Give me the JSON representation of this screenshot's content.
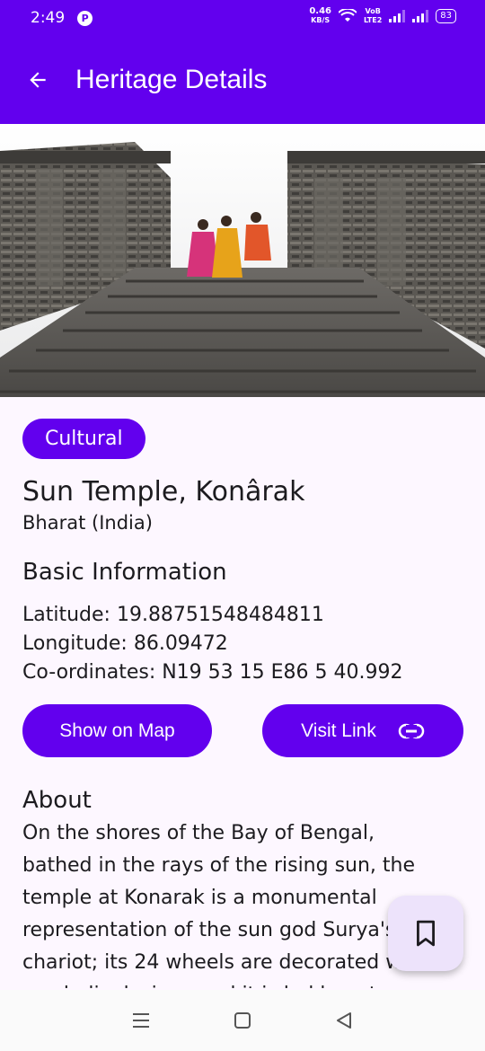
{
  "status_bar": {
    "time": "2:49",
    "indicator": "P",
    "net_speed_value": "0.46",
    "net_speed_unit": "KB/S",
    "volte_top": "VoB",
    "volte_bottom": "LTE2",
    "battery": "83"
  },
  "app_bar": {
    "title": "Heritage Details",
    "back_icon": "arrow-back-icon",
    "color": "#6200ee"
  },
  "hero_image": {
    "subject": "Sun Temple stone steps and walls with visitors"
  },
  "heritage": {
    "category": "Cultural",
    "name": "Sun Temple, Konârak",
    "country": "Bharat (India)"
  },
  "basic_info": {
    "heading": "Basic Information",
    "latitude": "Latitude: 19.88751548484811",
    "longitude": "Longitude: 86.09472",
    "coordinates": "Co-ordinates: N19 53 15 E86 5 40.992"
  },
  "actions": {
    "show_on_map": "Show on Map",
    "visit_link": "Visit Link",
    "visit_link_icon": "link-icon"
  },
  "about": {
    "heading": "About",
    "text": "On the shores of the Bay of Bengal, bathed in the rays of the rising sun, the temple at Konarak is a monumental representation of the sun god Surya's chariot; its 24 wheels are decorated with symbolic designs and it is led by a team"
  },
  "fab": {
    "icon": "bookmark-icon"
  },
  "nav_bar": {
    "recents_icon": "recents-icon",
    "home_icon": "home-icon",
    "back_icon": "back-triangle-icon"
  }
}
